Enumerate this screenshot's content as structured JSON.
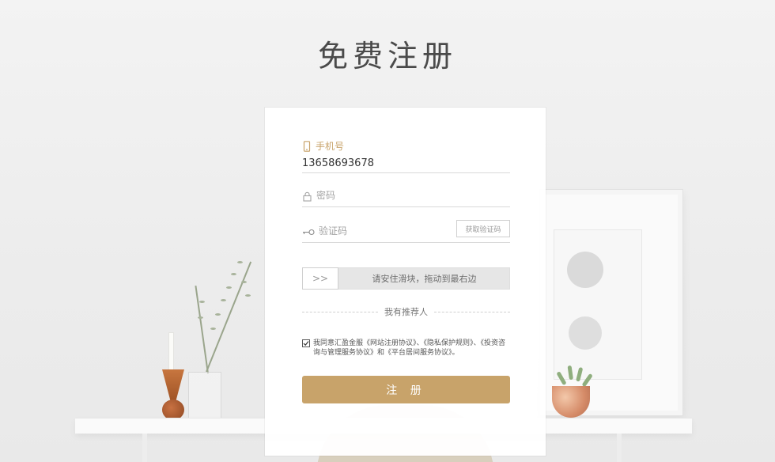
{
  "page": {
    "title": "免费注册"
  },
  "form": {
    "phone": {
      "label": "手机号",
      "value": "13658693678",
      "icon": "phone-icon"
    },
    "password": {
      "placeholder": "密码",
      "icon": "lock-icon"
    },
    "captcha": {
      "placeholder": "验证码",
      "icon": "key-icon",
      "get_code_label": "获取验证码"
    },
    "slider": {
      "handle_label": ">>",
      "hint": "请安住滑块，拖动到最右边"
    },
    "referrer": {
      "label": "我有推荐人"
    },
    "agreement": {
      "checked": true,
      "text": "我同意汇盈金服《网站注册协议》、《隐私保护规则》、《投资咨询与管理服务协议》和《平台居间服务协议》。"
    },
    "submit_label": "注 册"
  },
  "colors": {
    "accent": "#c8a36a",
    "text": "#333333",
    "placeholder": "#a3a3a3"
  }
}
